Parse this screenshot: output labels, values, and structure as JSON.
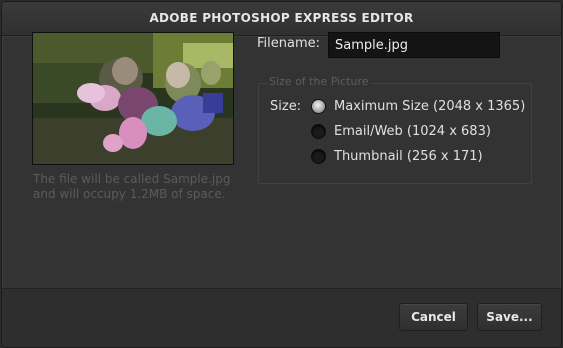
{
  "dialog": {
    "title": "ADOBE PHOTOSHOP EXPRESS EDITOR"
  },
  "preview": {
    "caption": "The file will be called Sample.jpg and will occupy 1.2MB of space."
  },
  "filename": {
    "label": "Filename:",
    "value": "Sample.jpg"
  },
  "size_group": {
    "legend": "Size of the Picture",
    "label": "Size:",
    "options": [
      {
        "label": "Maximum Size (2048 x 1365)",
        "selected": true
      },
      {
        "label": "Email/Web (1024 x 683)",
        "selected": false
      },
      {
        "label": "Thumbnail (256 x 171)",
        "selected": false
      }
    ]
  },
  "buttons": {
    "cancel": "Cancel",
    "save": "Save..."
  }
}
